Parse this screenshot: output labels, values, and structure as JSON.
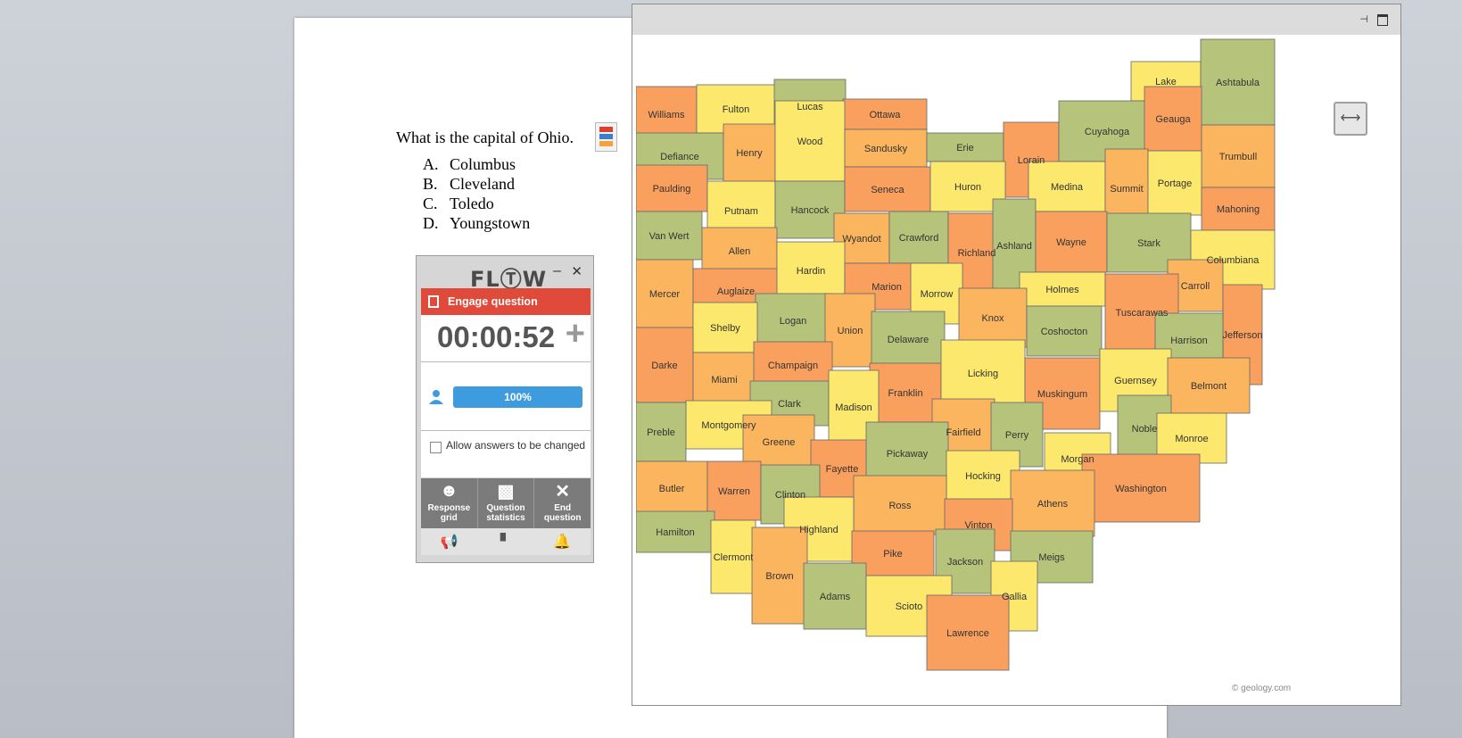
{
  "document": {
    "question": "What is the capital of Ohio.",
    "answers": [
      {
        "letter": "A.",
        "text": "Columbus"
      },
      {
        "letter": "B.",
        "text": "Cleveland"
      },
      {
        "letter": "C.",
        "text": "Toledo"
      },
      {
        "letter": "D.",
        "text": "Youngstown"
      }
    ]
  },
  "flow": {
    "logo": "FLⓉW",
    "minimize": "–",
    "close": "✕",
    "engage_label": "Engage question",
    "timer": "00:00:52",
    "plus": "+",
    "progress_fraction": 1.0,
    "progress_label": "100%",
    "allow_label": "Allow answers to be changed",
    "allow_checked": false,
    "buttons": [
      {
        "icon": "response-grid-icon",
        "label": "Response grid"
      },
      {
        "icon": "question-statistics-icon",
        "label": "Question statistics"
      },
      {
        "icon": "end-question-icon",
        "label": "End question"
      }
    ],
    "footer_icons": [
      "megaphone-icon",
      "podium-icon",
      "bell-icon"
    ]
  },
  "map": {
    "credit": "© geology.com",
    "colors": {
      "orange": "#f9a05f",
      "lightorange": "#fbb55f",
      "green": "#b5c47a",
      "yellow": "#fbe86c"
    },
    "counties": [
      {
        "name": "Williams",
        "c": "orange"
      },
      {
        "name": "Fulton",
        "c": "yellow"
      },
      {
        "name": "Lucas",
        "c": "green"
      },
      {
        "name": "Ottawa",
        "c": "orange"
      },
      {
        "name": "Lake",
        "c": "yellow"
      },
      {
        "name": "Ashtabula",
        "c": "green"
      },
      {
        "name": "Defiance",
        "c": "green"
      },
      {
        "name": "Henry",
        "c": "lightorange"
      },
      {
        "name": "Wood",
        "c": "yellow"
      },
      {
        "name": "Sandusky",
        "c": "lightorange"
      },
      {
        "name": "Erie",
        "c": "green"
      },
      {
        "name": "Lorain",
        "c": "orange"
      },
      {
        "name": "Cuyahoga",
        "c": "green"
      },
      {
        "name": "Geauga",
        "c": "orange"
      },
      {
        "name": "Trumbull",
        "c": "lightorange"
      },
      {
        "name": "Paulding",
        "c": "orange"
      },
      {
        "name": "Putnam",
        "c": "yellow"
      },
      {
        "name": "Hancock",
        "c": "green"
      },
      {
        "name": "Seneca",
        "c": "orange"
      },
      {
        "name": "Huron",
        "c": "yellow"
      },
      {
        "name": "Medina",
        "c": "yellow"
      },
      {
        "name": "Summit",
        "c": "lightorange"
      },
      {
        "name": "Portage",
        "c": "yellow"
      },
      {
        "name": "Mahoning",
        "c": "orange"
      },
      {
        "name": "Van Wert",
        "c": "green"
      },
      {
        "name": "Allen",
        "c": "lightorange"
      },
      {
        "name": "Wyandot",
        "c": "lightorange"
      },
      {
        "name": "Crawford",
        "c": "green"
      },
      {
        "name": "Richland",
        "c": "orange"
      },
      {
        "name": "Ashland",
        "c": "green"
      },
      {
        "name": "Wayne",
        "c": "orange"
      },
      {
        "name": "Stark",
        "c": "green"
      },
      {
        "name": "Columbiana",
        "c": "yellow"
      },
      {
        "name": "Mercer",
        "c": "lightorange"
      },
      {
        "name": "Auglaize",
        "c": "orange"
      },
      {
        "name": "Hardin",
        "c": "yellow"
      },
      {
        "name": "Marion",
        "c": "orange"
      },
      {
        "name": "Morrow",
        "c": "yellow"
      },
      {
        "name": "Holmes",
        "c": "yellow"
      },
      {
        "name": "Carroll",
        "c": "lightorange"
      },
      {
        "name": "Tuscarawas",
        "c": "orange"
      },
      {
        "name": "Jefferson",
        "c": "orange"
      },
      {
        "name": "Logan",
        "c": "green"
      },
      {
        "name": "Union",
        "c": "lightorange"
      },
      {
        "name": "Delaware",
        "c": "green"
      },
      {
        "name": "Knox",
        "c": "lightorange"
      },
      {
        "name": "Coshocton",
        "c": "green"
      },
      {
        "name": "Harrison",
        "c": "green"
      },
      {
        "name": "Shelby",
        "c": "yellow"
      },
      {
        "name": "Darke",
        "c": "orange"
      },
      {
        "name": "Miami",
        "c": "lightorange"
      },
      {
        "name": "Champaign",
        "c": "orange"
      },
      {
        "name": "Franklin",
        "c": "orange"
      },
      {
        "name": "Licking",
        "c": "yellow"
      },
      {
        "name": "Muskingum",
        "c": "orange"
      },
      {
        "name": "Guernsey",
        "c": "yellow"
      },
      {
        "name": "Belmont",
        "c": "lightorange"
      },
      {
        "name": "Clark",
        "c": "green"
      },
      {
        "name": "Madison",
        "c": "yellow"
      },
      {
        "name": "Montgomery",
        "c": "yellow"
      },
      {
        "name": "Preble",
        "c": "green"
      },
      {
        "name": "Greene",
        "c": "lightorange"
      },
      {
        "name": "Fairfield",
        "c": "lightorange"
      },
      {
        "name": "Perry",
        "c": "green"
      },
      {
        "name": "Noble",
        "c": "green"
      },
      {
        "name": "Monroe",
        "c": "yellow"
      },
      {
        "name": "Fayette",
        "c": "orange"
      },
      {
        "name": "Pickaway",
        "c": "green"
      },
      {
        "name": "Morgan",
        "c": "yellow"
      },
      {
        "name": "Butler",
        "c": "lightorange"
      },
      {
        "name": "Warren",
        "c": "orange"
      },
      {
        "name": "Clinton",
        "c": "green"
      },
      {
        "name": "Hocking",
        "c": "yellow"
      },
      {
        "name": "Washington",
        "c": "orange"
      },
      {
        "name": "Ross",
        "c": "lightorange"
      },
      {
        "name": "Athens",
        "c": "lightorange"
      },
      {
        "name": "Vinton",
        "c": "orange"
      },
      {
        "name": "Hamilton",
        "c": "green"
      },
      {
        "name": "Highland",
        "c": "yellow"
      },
      {
        "name": "Meigs",
        "c": "green"
      },
      {
        "name": "Clermont",
        "c": "yellow"
      },
      {
        "name": "Pike",
        "c": "orange"
      },
      {
        "name": "Jackson",
        "c": "green"
      },
      {
        "name": "Brown",
        "c": "lightorange"
      },
      {
        "name": "Adams",
        "c": "green"
      },
      {
        "name": "Gallia",
        "c": "yellow"
      },
      {
        "name": "Scioto",
        "c": "yellow"
      },
      {
        "name": "Lawrence",
        "c": "orange"
      }
    ]
  }
}
